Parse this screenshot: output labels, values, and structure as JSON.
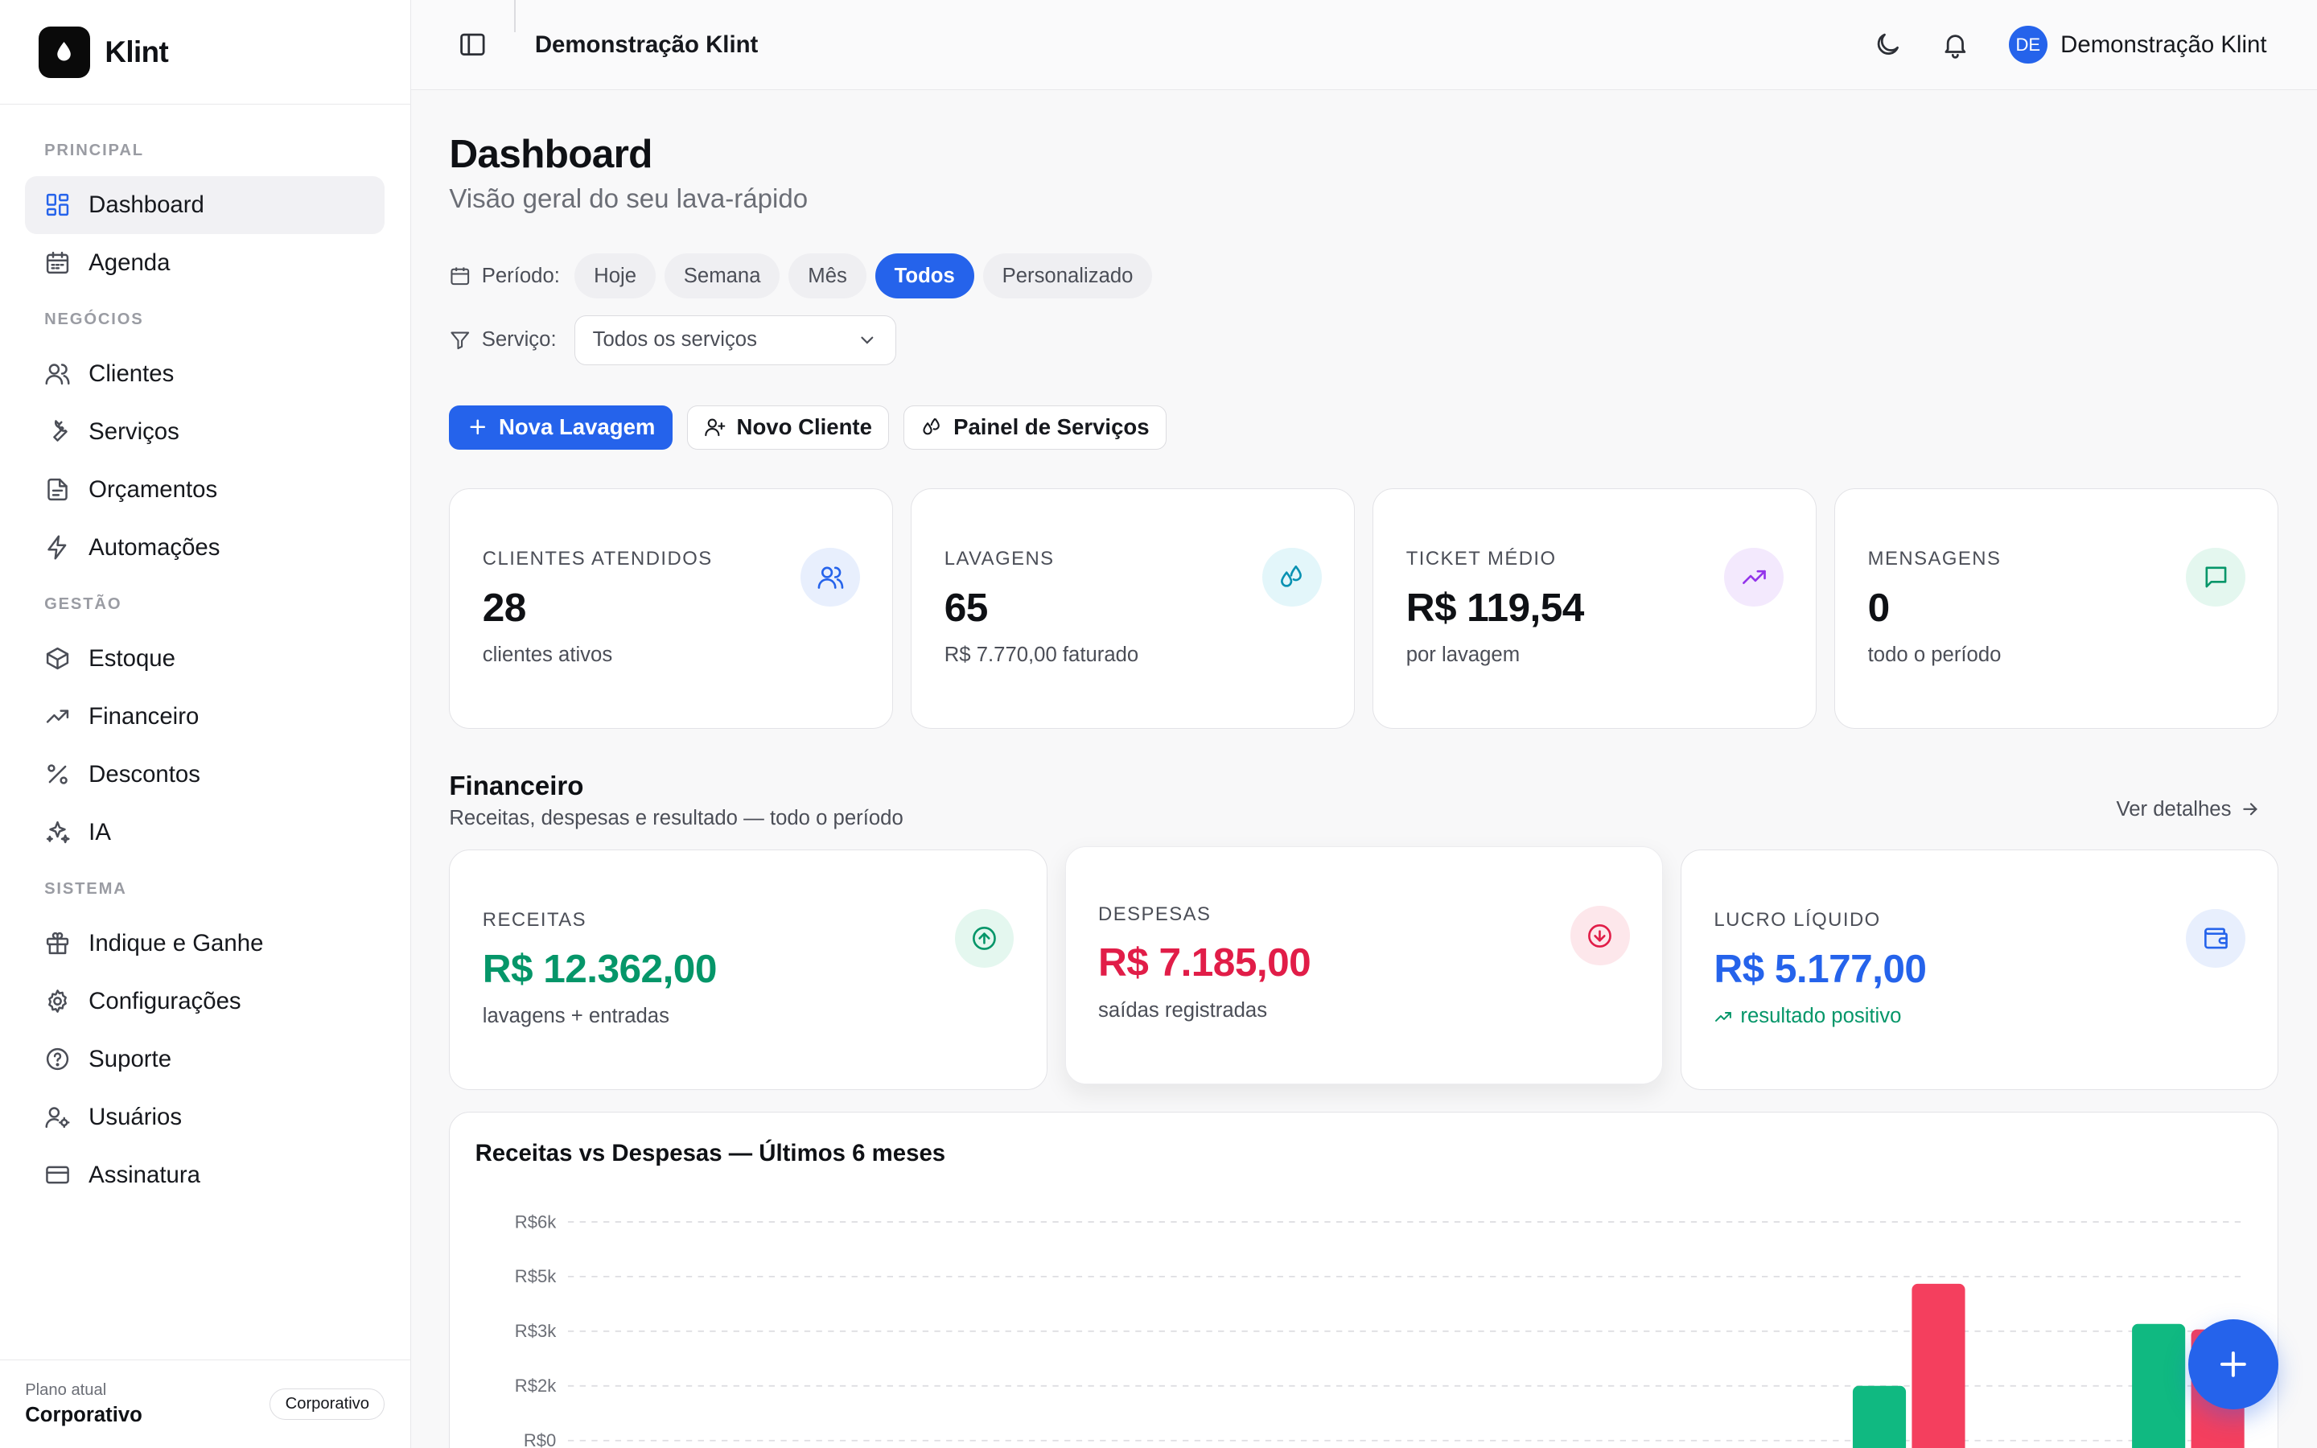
{
  "brand": {
    "name": "Klint"
  },
  "sidebar": {
    "sections": [
      {
        "title": "PRINCIPAL",
        "items": [
          {
            "label": "Dashboard",
            "icon": "layout-grid-icon",
            "active": true
          },
          {
            "label": "Agenda",
            "icon": "calendar-icon"
          }
        ]
      },
      {
        "title": "NEGÓCIOS",
        "items": [
          {
            "label": "Clientes",
            "icon": "users-icon"
          },
          {
            "label": "Serviços",
            "icon": "wrench-icon"
          },
          {
            "label": "Orçamentos",
            "icon": "file-text-icon"
          },
          {
            "label": "Automações",
            "icon": "zap-icon"
          }
        ]
      },
      {
        "title": "GESTÃO",
        "items": [
          {
            "label": "Estoque",
            "icon": "package-icon"
          },
          {
            "label": "Financeiro",
            "icon": "trending-up-icon"
          },
          {
            "label": "Descontos",
            "icon": "percent-icon"
          },
          {
            "label": "IA",
            "icon": "sparkles-icon"
          }
        ]
      },
      {
        "title": "SISTEMA",
        "items": [
          {
            "label": "Indique e Ganhe",
            "icon": "gift-icon"
          },
          {
            "label": "Configurações",
            "icon": "gear-icon"
          },
          {
            "label": "Suporte",
            "icon": "help-circle-icon"
          },
          {
            "label": "Usuários",
            "icon": "user-cog-icon"
          },
          {
            "label": "Assinatura",
            "icon": "credit-card-icon"
          }
        ]
      }
    ],
    "plan": {
      "label": "Plano atual",
      "name": "Corporativo",
      "badge": "Corporativo"
    }
  },
  "topbar": {
    "title": "Demonstração Klint",
    "user_initials": "DE",
    "user_name": "Demonstração Klint"
  },
  "page": {
    "title": "Dashboard",
    "subtitle": "Visão geral do seu lava-rápido"
  },
  "filters": {
    "period_label": "Período:",
    "period_options": [
      "Hoje",
      "Semana",
      "Mês",
      "Todos",
      "Personalizado"
    ],
    "period_selected": "Todos",
    "service_label": "Serviço:",
    "service_value": "Todos os serviços"
  },
  "actions": {
    "new_wash": "Nova Lavagem",
    "new_client": "Novo Cliente",
    "services_panel": "Painel de Serviços"
  },
  "stats": [
    {
      "label": "CLIENTES ATENDIDOS",
      "value": "28",
      "sub": "clientes ativos",
      "icon": "users-icon",
      "color": "#2563eb",
      "bg": "#e8effd"
    },
    {
      "label": "LAVAGENS",
      "value": "65",
      "sub": "R$ 7.770,00 faturado",
      "icon": "droplets-icon",
      "color": "#0891b2",
      "bg": "#e3f6fa"
    },
    {
      "label": "TICKET MÉDIO",
      "value": "R$ 119,54",
      "sub": "por lavagem",
      "icon": "trending-up-icon",
      "color": "#9333ea",
      "bg": "#f3e9fd"
    },
    {
      "label": "MENSAGENS",
      "value": "0",
      "sub": "todo o período",
      "icon": "message-square-icon",
      "color": "#059669",
      "bg": "#e4f7ef"
    }
  ],
  "financeiro": {
    "title": "Financeiro",
    "subtitle": "Receitas, despesas e resultado — todo o período",
    "link": "Ver detalhes",
    "cards": [
      {
        "label": "RECEITAS",
        "value": "R$ 12.362,00",
        "sub": "lavagens + entradas",
        "color": "#059669",
        "bg": "#e4f7ef",
        "icon": "arrow-up-circle-icon"
      },
      {
        "label": "DESPESAS",
        "value": "R$ 7.185,00",
        "sub": "saídas registradas",
        "color": "#e11d48",
        "bg": "#fde7eb",
        "icon": "arrow-down-circle-icon"
      },
      {
        "label": "LUCRO LÍQUIDO",
        "value": "R$ 5.177,00",
        "sub": "resultado positivo",
        "color": "#2563eb",
        "bg": "#e8effd",
        "icon": "wallet-icon",
        "sub_color": "#059669"
      }
    ]
  },
  "chart_data": {
    "type": "bar",
    "title": "Receitas vs Despesas — Últimos 6 meses",
    "y_ticks": [
      "R$0",
      "R$2k",
      "R$3k",
      "R$5k",
      "R$6k"
    ],
    "y_tick_values": [
      0,
      1500,
      3000,
      4500,
      6000
    ],
    "ylim": [
      0,
      6000
    ],
    "grid": true,
    "series": [
      {
        "color": "#10b981",
        "values": [
          0,
          0,
          0,
          0,
          1500,
          3200
        ]
      },
      {
        "color": "#f43f5e",
        "values": [
          0,
          0,
          0,
          0,
          4300,
          3050
        ]
      }
    ]
  }
}
